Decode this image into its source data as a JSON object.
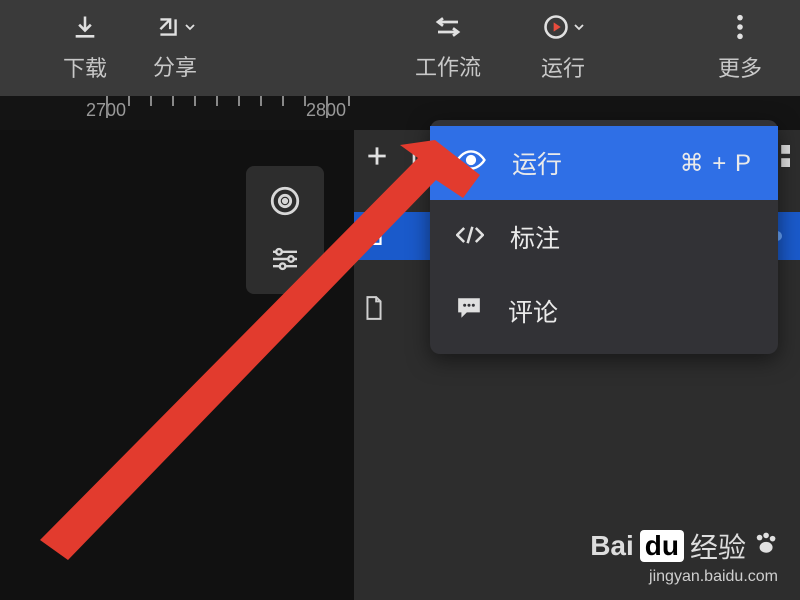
{
  "toolbar": {
    "download": "下载",
    "share": "分享",
    "workflow": "工作流",
    "run": "运行",
    "more": "更多"
  },
  "ruler": {
    "tick1": "2700",
    "tick2": "2800"
  },
  "dropdown": {
    "run": {
      "label": "运行",
      "shortcut": "⌘ + P"
    },
    "annotate": {
      "label": "标注"
    },
    "comment": {
      "label": "评论"
    }
  },
  "watermark": {
    "bai": "Bai",
    "du": "du",
    "suffix": "经验",
    "url": "jingyan.baidu.com"
  }
}
